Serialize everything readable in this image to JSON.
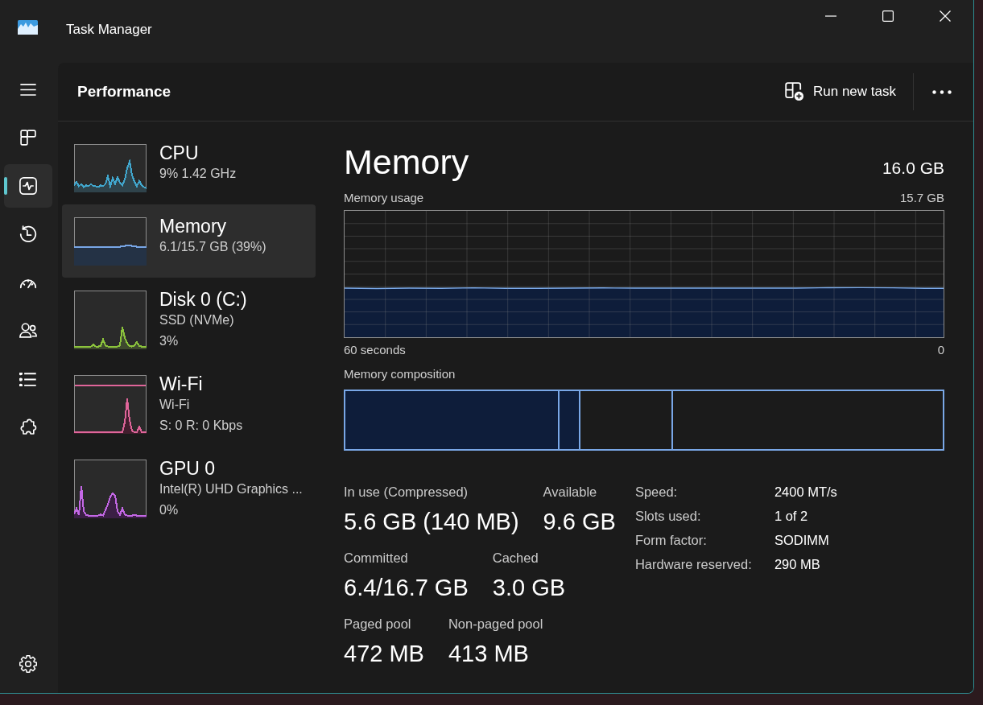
{
  "window": {
    "title": "Task Manager"
  },
  "nav_rail": {
    "pages": [
      {
        "selected": false
      },
      {
        "selected": true
      },
      {
        "selected": false
      },
      {
        "selected": false
      },
      {
        "selected": false
      },
      {
        "selected": false
      },
      {
        "selected": false
      }
    ]
  },
  "header": {
    "title": "Performance",
    "action": "Run new task"
  },
  "resources": [
    {
      "name": "CPU",
      "details": [
        "9% 1.42 GHz"
      ],
      "color": "#41a8cf",
      "selected": false
    },
    {
      "name": "Memory",
      "details": [
        "6.1/15.7 GB (39%)"
      ],
      "color": "#78a6e6",
      "selected": true
    },
    {
      "name": "Disk 0 (C:)",
      "details": [
        "SSD (NVMe)",
        "3%"
      ],
      "color": "#8cc43c",
      "selected": false
    },
    {
      "name": "Wi-Fi",
      "details": [
        "Wi-Fi",
        "S: 0 R: 0 Kbps"
      ],
      "color": "#e0659a",
      "selected": false
    },
    {
      "name": "GPU 0",
      "details": [
        "Intel(R) UHD Graphics ...",
        "0%"
      ],
      "color": "#c468e6",
      "selected": false
    }
  ],
  "detail": {
    "title": "Memory",
    "capacity": "16.0 GB",
    "usage_graph": {
      "label": "Memory usage",
      "max_label": "15.7 GB",
      "start_label": "60 seconds",
      "end_label": "0"
    },
    "composition": {
      "label": "Memory composition"
    },
    "stats": [
      [
        {
          "label": "In use (Compressed)",
          "value": "5.6 GB (140 MB)"
        },
        {
          "label": "Available",
          "value": "9.6 GB"
        }
      ],
      [
        {
          "label": "Committed",
          "value": "6.4/16.7 GB"
        },
        {
          "label": "Cached",
          "value": "3.0 GB"
        }
      ],
      [
        {
          "label": "Paged pool",
          "value": "472 MB"
        },
        {
          "label": "Non-paged pool",
          "value": "413 MB"
        }
      ]
    ],
    "specs": [
      {
        "label": "Speed:",
        "value": "2400 MT/s"
      },
      {
        "label": "Slots used:",
        "value": "1 of 2"
      },
      {
        "label": "Form factor:",
        "value": "SODIMM"
      },
      {
        "label": "Hardware reserved:",
        "value": "290 MB"
      }
    ]
  }
}
